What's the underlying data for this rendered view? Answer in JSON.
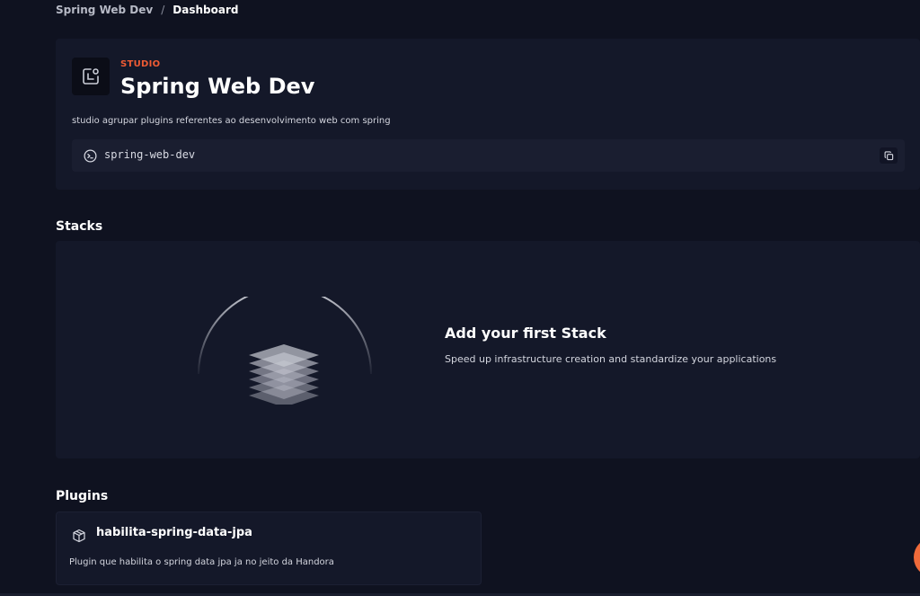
{
  "breadcrumb": {
    "parent": "Spring Web Dev",
    "separator": "/",
    "current": "Dashboard"
  },
  "studio": {
    "kind_label": "STUDIO",
    "title": "Spring Web Dev",
    "description": "studio agrupar plugins referentes ao desenvolvimento web com spring",
    "slug": "spring-web-dev",
    "icon": "studio-icon",
    "slug_icon": "terminal-icon",
    "copy_icon": "copy-icon"
  },
  "stacks": {
    "heading": "Stacks",
    "empty_title": "Add your first Stack",
    "empty_subtitle": "Speed up infrastructure creation and standardize your applications",
    "illustration_icon": "layers-icon"
  },
  "plugins": {
    "heading": "Plugins",
    "items": [
      {
        "name": "habilita-spring-data-jpa",
        "description": "Plugin que habilita o spring data jpa ja no jeito da Handora",
        "icon": "box-icon"
      }
    ]
  },
  "colors": {
    "background": "#0f1220",
    "card": "#141829",
    "accent": "#ef5b34",
    "fab": "#ef6a3a"
  }
}
